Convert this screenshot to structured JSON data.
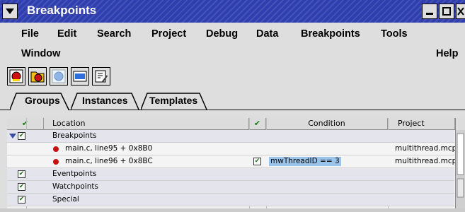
{
  "window": {
    "title": "Breakpoints"
  },
  "menubar": {
    "items": [
      "File",
      "Edit",
      "Search",
      "Project",
      "Debug",
      "Data",
      "Breakpoints",
      "Tools"
    ],
    "window_label": "Window",
    "help_label": "Help"
  },
  "toolbar": {
    "buttons": [
      "breakpoint-icon",
      "breakpoint-folder-icon",
      "disabled-breakpoint-icon",
      "window-icon",
      "edit-icon"
    ]
  },
  "tabs": [
    {
      "label": "Groups",
      "active": true
    },
    {
      "label": "Instances",
      "active": false
    },
    {
      "label": "Templates",
      "active": false
    }
  ],
  "table": {
    "headers": {
      "check": "✔",
      "location": "Location",
      "check2": "✔",
      "condition": "Condition",
      "project": "Project"
    },
    "rows": [
      {
        "location": "Breakpoints",
        "condition": "",
        "project": "",
        "group": true,
        "checked": true,
        "expanded": true
      },
      {
        "location": "main.c, line95 + 0x8B0",
        "condition": "",
        "project": "multithread.mcp",
        "group": false,
        "checked2": false
      },
      {
        "location": "main.c, line96 + 0x8BC",
        "condition": "mwThreadID == 3",
        "project": "multithread.mcp",
        "group": false,
        "checked2": true
      },
      {
        "location": "Eventpoints",
        "condition": "",
        "project": "",
        "group": true,
        "checked": true
      },
      {
        "location": "Watchpoints",
        "condition": "",
        "project": "",
        "group": true,
        "checked": true
      },
      {
        "location": "Special",
        "condition": "",
        "project": "",
        "group": true,
        "checked": true
      }
    ]
  },
  "colors": {
    "titlebar": "#2f3eae",
    "breakpoint": "#cc1010",
    "highlight": "#9bc4ea"
  }
}
